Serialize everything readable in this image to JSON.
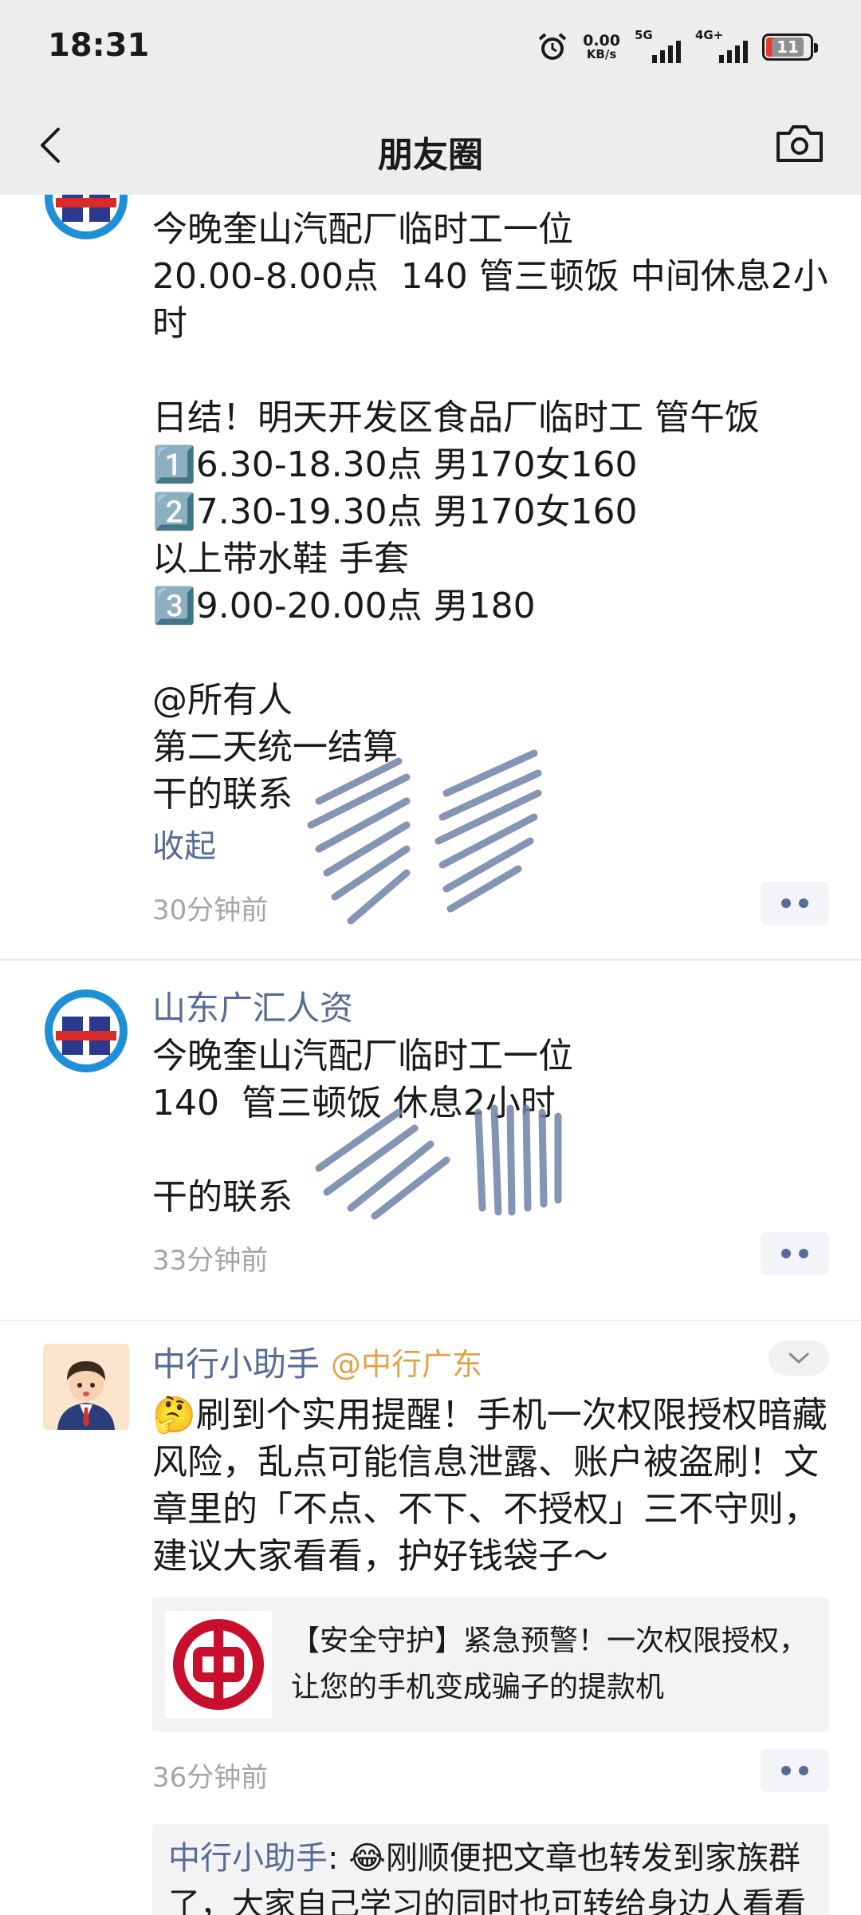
{
  "status_bar": {
    "time": "18:31",
    "net_speed_value": "0.00",
    "net_speed_unit": "KB/s",
    "sim1_label": "5G",
    "sim2_label": "4G+",
    "battery_level": "11"
  },
  "nav": {
    "title": "朋友圈"
  },
  "posts": [
    {
      "text": "今晚奎山汽配厂临时工一位\n20.00-8.00点  140 管三顿饭 中间休息2小时\n\n日结！明天开发区食品厂临时工 管午饭\n1️⃣6.30-18.30点 男170女160\n2️⃣7.30-19.30点 男170女160\n以上带水鞋 手套\n3️⃣9.00-20.00点 男180\n\n@所有人\n第二天统一结算\n干的联系",
      "collapse_label": "收起",
      "time": "30分钟前"
    },
    {
      "author": "山东广汇人资",
      "text": "今晚奎山汽配厂临时工一位\n140  管三顿饭 休息2小时\n\n干的联系",
      "time": "33分钟前"
    },
    {
      "author": "中行小助手",
      "author_sub": "@中行广东",
      "text": "🤔刷到个实用提醒！手机一次权限授权暗藏风险，乱点可能信息泄露、账户被盗刷！文章里的「不点、不下、不授权」三不守则，建议大家看看，护好钱袋子～",
      "link_title": "【安全守护】紧急预警！一次权限授权，让您的手机变成骗子的提款机",
      "time": "36分钟前",
      "comment_author": "中行小助手",
      "comment_text": ": 😂刚顺便把文章也转发到家族群了，大家自己学习的同时也可转给身边人看看"
    }
  ],
  "colors": {
    "link_blue": "#576b95",
    "brand_red": "#c8102e",
    "nav_bg": "#ededed"
  }
}
